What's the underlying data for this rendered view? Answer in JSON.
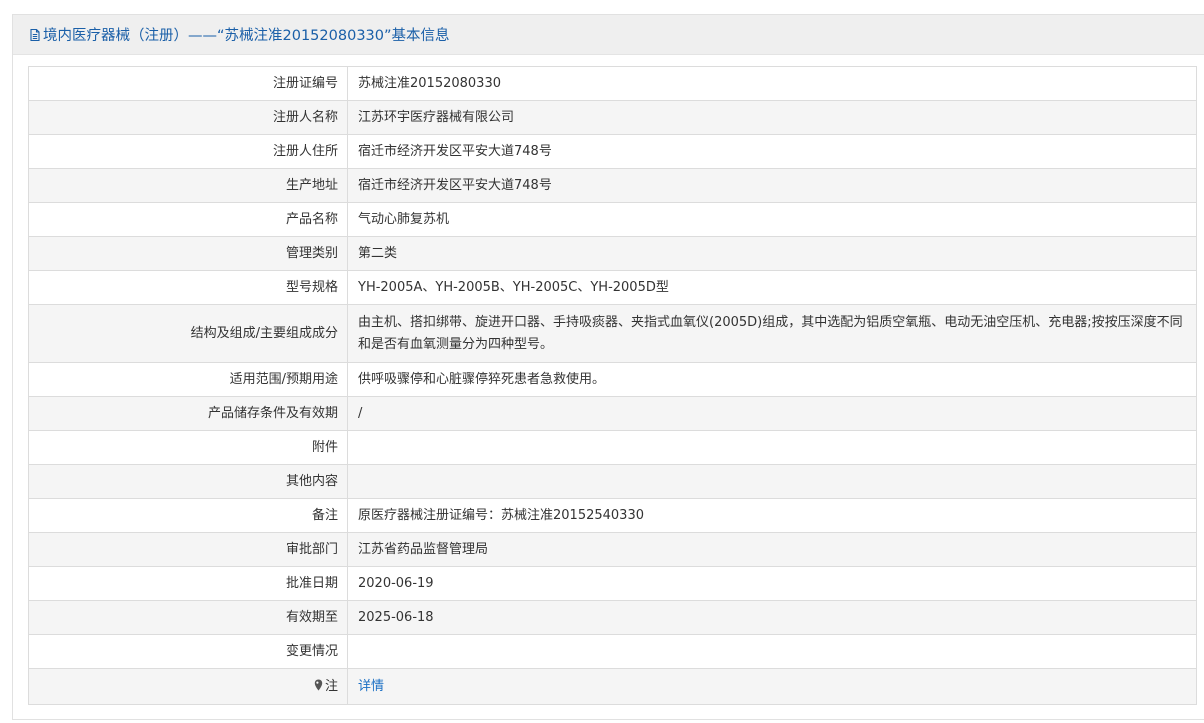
{
  "header": {
    "title": "境内医疗器械（注册）——“苏械注准20152080330”基本信息",
    "icon": "document-icon"
  },
  "rows": [
    {
      "label": "注册证编号",
      "value": "苏械注准20152080330"
    },
    {
      "label": "注册人名称",
      "value": "江苏环宇医疗器械有限公司"
    },
    {
      "label": "注册人住所",
      "value": "宿迁市经济开发区平安大道748号"
    },
    {
      "label": "生产地址",
      "value": "宿迁市经济开发区平安大道748号"
    },
    {
      "label": "产品名称",
      "value": "气动心肺复苏机"
    },
    {
      "label": "管理类别",
      "value": "第二类"
    },
    {
      "label": "型号规格",
      "value": "YH-2005A、YH-2005B、YH-2005C、YH-2005D型"
    },
    {
      "label": "结构及组成/主要组成成分",
      "value": "由主机、搭扣绑带、旋进开口器、手持吸痰器、夹指式血氧仪(2005D)组成，其中选配为铝质空氧瓶、电动无油空压机、充电器;按按压深度不同和是否有血氧测量分为四种型号。"
    },
    {
      "label": "适用范围/预期用途",
      "value": "供呼吸骤停和心脏骤停猝死患者急救使用。"
    },
    {
      "label": "产品储存条件及有效期",
      "value": "/"
    },
    {
      "label": "附件",
      "value": ""
    },
    {
      "label": "其他内容",
      "value": ""
    },
    {
      "label": "备注",
      "value": "原医疗器械注册证编号：苏械注准20152540330"
    },
    {
      "label": "审批部门",
      "value": "江苏省药品监督管理局"
    },
    {
      "label": "批准日期",
      "value": "2020-06-19"
    },
    {
      "label": "有效期至",
      "value": "2025-06-18"
    },
    {
      "label": "变更情况",
      "value": ""
    }
  ],
  "note": {
    "label": "注",
    "icon": "map-pin-icon",
    "link_text": "详情"
  },
  "colors": {
    "header_text": "#1a5fa8",
    "link": "#1a6fc4",
    "header_bg": "#efefef",
    "row_alt_bg": "#f5f5f5",
    "border": "#dcdcdc"
  }
}
